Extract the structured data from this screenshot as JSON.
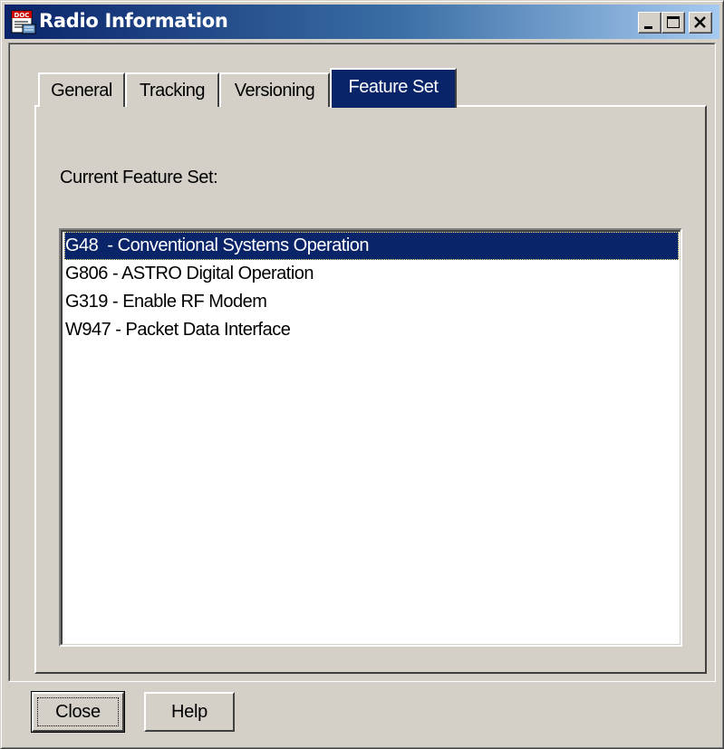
{
  "window": {
    "title": "Radio Information",
    "icon": "doc-icon",
    "icon_text": "DOC",
    "controls": {
      "minimize": "minimize-icon",
      "maximize": "maximize-icon",
      "close": "close-icon"
    }
  },
  "tabs": [
    {
      "label": "General"
    },
    {
      "label": "Tracking"
    },
    {
      "label": "Versioning"
    },
    {
      "label": "Feature Set",
      "active": true
    }
  ],
  "panel": {
    "label": "Current Feature Set:",
    "items": [
      {
        "text": "G48  - Conventional Systems Operation",
        "selected": true
      },
      {
        "text": "G806 - ASTRO Digital Operation"
      },
      {
        "text": "G319 - Enable RF Modem"
      },
      {
        "text": "W947 - Packet Data Interface"
      }
    ]
  },
  "buttons": {
    "close_label": "Close",
    "help_label": "Help"
  },
  "colors": {
    "face": "#d4d0c8",
    "selection": "#0a246a",
    "title_gradient_start": "#0a246a",
    "title_gradient_end": "#a6caf0"
  }
}
